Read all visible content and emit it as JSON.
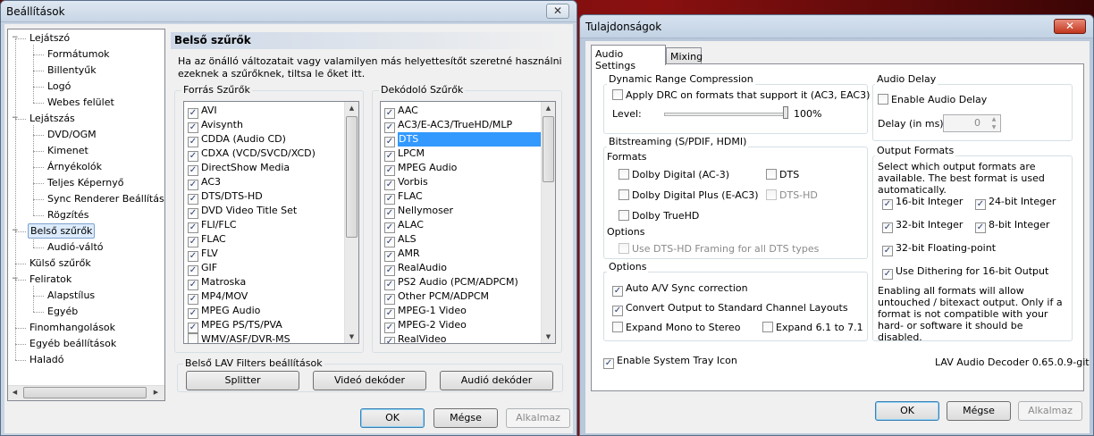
{
  "win1": {
    "title": "Beállítások",
    "close": "✕"
  },
  "tree": [
    {
      "label": "Lejátszó",
      "depth": 0,
      "expand": "−"
    },
    {
      "label": "Formátumok",
      "depth": 1
    },
    {
      "label": "Billentyűk",
      "depth": 1
    },
    {
      "label": "Logó",
      "depth": 1
    },
    {
      "label": "Webes felület",
      "depth": 1
    },
    {
      "label": "Lejátszás",
      "depth": 0,
      "expand": "−"
    },
    {
      "label": "DVD/OGM",
      "depth": 1
    },
    {
      "label": "Kimenet",
      "depth": 1
    },
    {
      "label": "Árnyékolók",
      "depth": 1
    },
    {
      "label": "Teljes Képernyő",
      "depth": 1
    },
    {
      "label": "Sync Renderer Beállítások",
      "depth": 1
    },
    {
      "label": "Rögzítés",
      "depth": 1
    },
    {
      "label": "Belső szűrők",
      "depth": 0,
      "expand": "−",
      "selected": true
    },
    {
      "label": "Audió-váltó",
      "depth": 1
    },
    {
      "label": "Külső szűrők",
      "depth": 0
    },
    {
      "label": "Feliratok",
      "depth": 0,
      "expand": "−"
    },
    {
      "label": "Alapstílus",
      "depth": 1
    },
    {
      "label": "Egyéb",
      "depth": 1
    },
    {
      "label": "Finomhangolások",
      "depth": 0
    },
    {
      "label": "Egyéb beállítások",
      "depth": 0
    },
    {
      "label": "Haladó",
      "depth": 0
    }
  ],
  "panel": {
    "header": "Belső szűrők",
    "description": "Ha az önálló változatait vagy valamilyen más helyettesítőt szeretné használni ezeknek a szűrőknek, tiltsa le őket itt.",
    "source_label": "Forrás Szűrők",
    "decoder_label": "Dekódoló Szűrők",
    "lav_label": "Belső LAV Filters beállítások",
    "splitter": "Splitter",
    "video_decoder": "Videó dekóder",
    "audio_decoder": "Audió dekóder"
  },
  "source_filters": [
    {
      "label": "AVI",
      "checked": true
    },
    {
      "label": "Avisynth",
      "checked": true
    },
    {
      "label": "CDDA (Audio CD)",
      "checked": true
    },
    {
      "label": "CDXA (VCD/SVCD/XCD)",
      "checked": true
    },
    {
      "label": "DirectShow Media",
      "checked": true
    },
    {
      "label": "AC3",
      "checked": true
    },
    {
      "label": "DTS/DTS-HD",
      "checked": true
    },
    {
      "label": "DVD Video Title Set",
      "checked": true
    },
    {
      "label": "FLI/FLC",
      "checked": true
    },
    {
      "label": "FLAC",
      "checked": true
    },
    {
      "label": "FLV",
      "checked": true
    },
    {
      "label": "GIF",
      "checked": true
    },
    {
      "label": "Matroska",
      "checked": true
    },
    {
      "label": "MP4/MOV",
      "checked": true
    },
    {
      "label": "MPEG Audio",
      "checked": true
    },
    {
      "label": "MPEG PS/TS/PVA",
      "checked": true
    },
    {
      "label": "WMV/ASF/DVR-MS",
      "checked": false
    }
  ],
  "decoder_filters": [
    {
      "label": "AAC",
      "checked": true
    },
    {
      "label": "AC3/E-AC3/TrueHD/MLP",
      "checked": true
    },
    {
      "label": "DTS",
      "checked": true,
      "selected": true
    },
    {
      "label": "LPCM",
      "checked": true
    },
    {
      "label": "MPEG Audio",
      "checked": true
    },
    {
      "label": "Vorbis",
      "checked": true
    },
    {
      "label": "FLAC",
      "checked": true
    },
    {
      "label": "Nellymoser",
      "checked": true
    },
    {
      "label": "ALAC",
      "checked": true
    },
    {
      "label": "ALS",
      "checked": true
    },
    {
      "label": "AMR",
      "checked": true
    },
    {
      "label": "RealAudio",
      "checked": true
    },
    {
      "label": "PS2 Audio (PCM/ADPCM)",
      "checked": true
    },
    {
      "label": "Other PCM/ADPCM",
      "checked": true
    },
    {
      "label": "MPEG-1 Video",
      "checked": true
    },
    {
      "label": "MPEG-2 Video",
      "checked": true
    },
    {
      "label": "RealVideo",
      "checked": true
    }
  ],
  "win1_buttons": {
    "ok": "OK",
    "cancel": "Mégse",
    "apply": "Alkalmaz"
  },
  "win2": {
    "title": "Tulajdonságok",
    "close": "✕",
    "tabs": [
      "Audio Settings",
      "Mixing"
    ],
    "drc": {
      "label": "Dynamic Range Compression",
      "apply": "Apply DRC on formats that support it (AC3, EAC3)",
      "level_label": "Level:",
      "level_value": "100%",
      "level_fraction": 1.0
    },
    "bitstream": {
      "label": "Bitstreaming (S/PDIF, HDMI)",
      "formats_label": "Formats",
      "ac3": "Dolby Digital (AC-3)",
      "dts": "DTS",
      "eac3": "Dolby Digital Plus (E-AC3)",
      "dtshd": "DTS-HD",
      "truehd": "Dolby TrueHD",
      "options_label": "Options",
      "framing": "Use DTS-HD Framing for all DTS types"
    },
    "options": {
      "label": "Options",
      "autosync": "Auto A/V Sync correction",
      "convert": "Convert Output to Standard Channel Layouts",
      "mono": "Expand Mono to Stereo",
      "expand61": "Expand 6.1 to 7.1"
    },
    "delay": {
      "label": "Audio Delay",
      "enable": "Enable Audio Delay",
      "delay_label": "Delay (in ms):",
      "value": "0"
    },
    "outformats": {
      "label": "Output Formats",
      "desc": "Select which output formats are available. The best format is used automatically.",
      "i16": "16-bit Integer",
      "i24": "24-bit Integer",
      "i32": "32-bit Integer",
      "i8": "8-bit Integer",
      "f32": "32-bit Floating-point",
      "dither": "Use Dithering for 16-bit Output",
      "note": "Enabling all formats will allow untouched / bitexact output. Only if a format is not compatible with your hard- or software it should be disabled."
    },
    "tray": "Enable System Tray Icon",
    "version": "LAV Audio Decoder 0.65.0.9-git",
    "buttons": {
      "ok": "OK",
      "cancel": "Mégse",
      "apply": "Alkalmaz"
    }
  }
}
